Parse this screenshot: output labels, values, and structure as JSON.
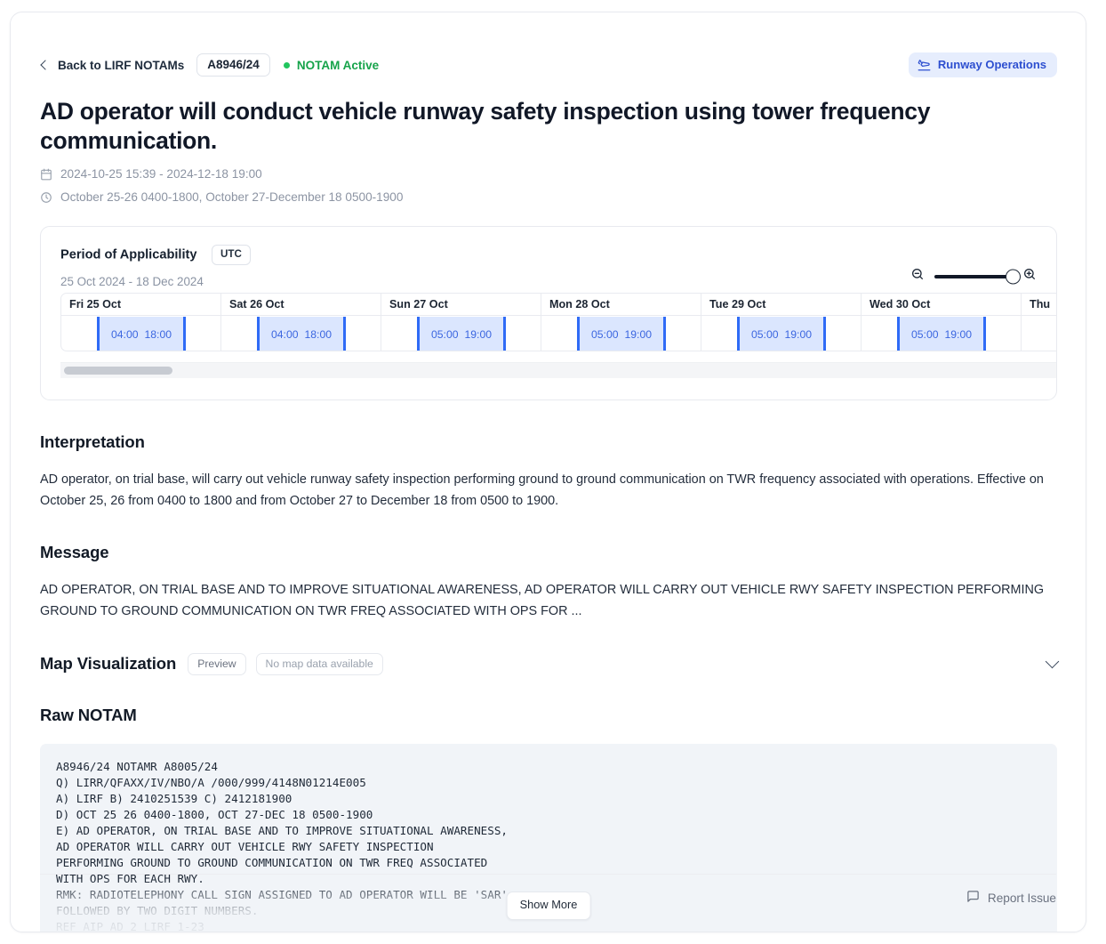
{
  "header": {
    "back_label": "Back to LIRF NOTAMs",
    "notam_id": "A8946/24",
    "status_label": "NOTAM Active",
    "status_color": "#16a34a",
    "tag_label": "Runway Operations",
    "tag_icon": "plane-takeoff-icon",
    "tag_color": "#2d4fd0",
    "tag_bg": "#e6edfd"
  },
  "title": "AD operator will conduct vehicle runway safety inspection using tower frequency communication.",
  "meta": {
    "calendar_icon": "calendar-icon",
    "date_range": "2024-10-25 15:39 - 2024-12-18 19:00",
    "clock_icon": "clock-icon",
    "schedule": "October 25-26 0400-1800, October 27-December 18 0500-1900"
  },
  "period": {
    "title": "Period of Applicability",
    "timezone_chip": "UTC",
    "subtitle": "25 Oct 2024 - 18 Dec 2024",
    "zoom_out_icon": "zoom-out-icon",
    "zoom_in_icon": "zoom-in-icon",
    "slider_value": 100
  },
  "timeline": {
    "columns": [
      {
        "label": "Fri 25 Oct",
        "start": "04:00",
        "end": "18:00"
      },
      {
        "label": "Sat 26 Oct",
        "start": "04:00",
        "end": "18:00"
      },
      {
        "label": "Sun 27 Oct",
        "start": "05:00",
        "end": "19:00"
      },
      {
        "label": "Mon 28 Oct",
        "start": "05:00",
        "end": "19:00"
      },
      {
        "label": "Tue 29 Oct",
        "start": "05:00",
        "end": "19:00"
      },
      {
        "label": "Wed 30 Oct",
        "start": "05:00",
        "end": "19:00"
      },
      {
        "label": "Thu",
        "start": "",
        "end": ""
      }
    ],
    "band_color": "#dbe6fe",
    "band_edge_color": "#2f6bf6"
  },
  "interpretation": {
    "heading": "Interpretation",
    "text": "AD operator, on trial base, will carry out vehicle runway safety inspection performing ground to ground communication on TWR frequency associated with operations. Effective on October 25, 26 from 0400 to 1800 and from October 27 to December 18 from 0500 to 1900."
  },
  "message": {
    "heading": "Message",
    "text": "AD OPERATOR, ON TRIAL BASE AND TO IMPROVE SITUATIONAL AWARENESS, AD OPERATOR WILL CARRY OUT VEHICLE RWY SAFETY INSPECTION PERFORMING GROUND TO GROUND COMMUNICATION ON TWR FREQ ASSOCIATED WITH OPS FOR ..."
  },
  "map": {
    "heading": "Map Visualization",
    "preview_label": "Preview",
    "no_data_label": "No map data available",
    "chevron_icon": "chevron-down-icon"
  },
  "raw": {
    "heading": "Raw NOTAM",
    "text": "A8946/24 NOTAMR A8005/24\nQ) LIRR/QFAXX/IV/NBO/A /000/999/4148N01214E005\nA) LIRF B) 2410251539 C) 2412181900\nD) OCT 25 26 0400-1800, OCT 27-DEC 18 0500-1900\nE) AD OPERATOR, ON TRIAL BASE AND TO IMPROVE SITUATIONAL AWARENESS,\nAD OPERATOR WILL CARRY OUT VEHICLE RWY SAFETY INSPECTION\nPERFORMING GROUND TO GROUND COMMUNICATION ON TWR FREQ ASSOCIATED\nWITH OPS FOR EACH RWY.\nRMK: RADIOTELEPHONY CALL SIGN ASSIGNED TO AD OPERATOR WILL BE 'SAR'\nFOLLOWED BY TWO DIGIT NUMBERS.\nREF AIP AD 2 LIRF 1-23",
    "show_more_label": "Show More"
  },
  "footer": {
    "report_icon": "message-square-icon",
    "report_label": "Report Issue"
  }
}
